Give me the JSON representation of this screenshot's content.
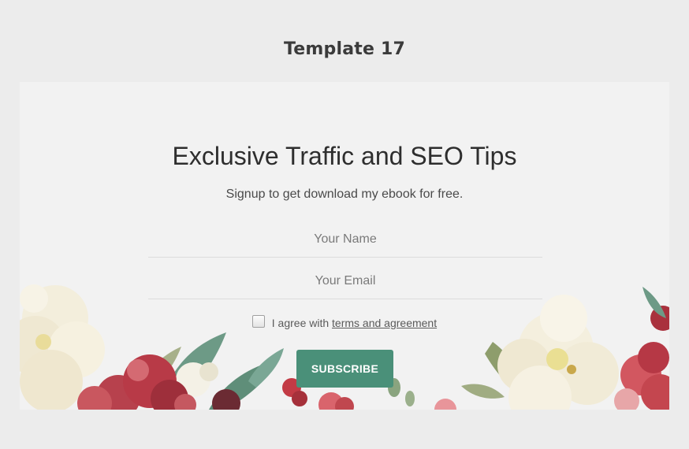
{
  "page": {
    "heading": "Template 17"
  },
  "form": {
    "title": "Exclusive Traffic and SEO Tips",
    "subtitle": "Signup to get download my ebook for free.",
    "name_placeholder": "Your Name",
    "email_placeholder": "Your Email",
    "agree_text": "I agree with",
    "terms_link": "terms and agreement",
    "agree_checked": false,
    "submit_label": "SUBSCRIBE"
  },
  "colors": {
    "page_background": "#ececec",
    "card_background": "#f2f2f2",
    "button": "#4a9079",
    "peony_white": "#f3eedc",
    "peony_red": "#b83a47",
    "leaf_green": "#6d9a86"
  }
}
